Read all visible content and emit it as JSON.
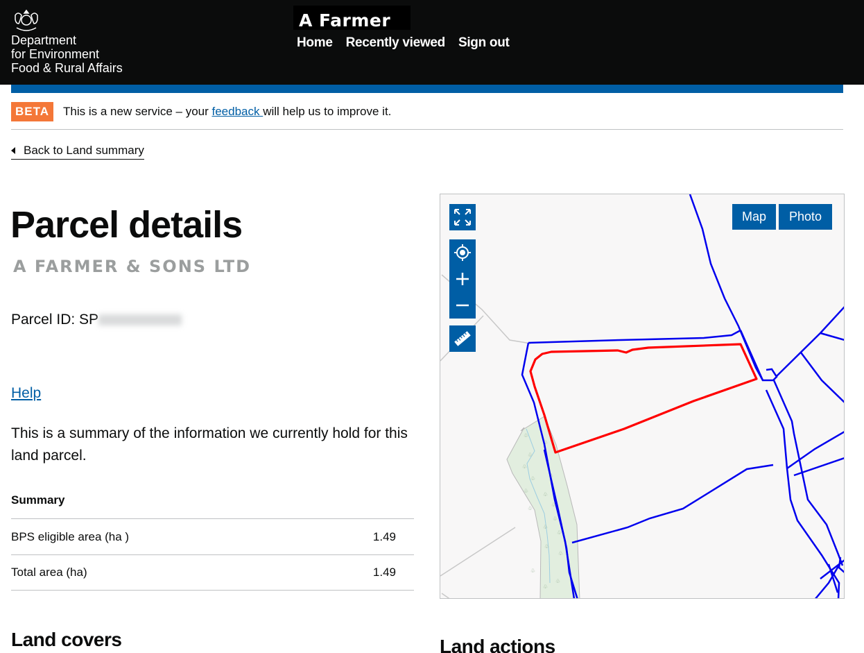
{
  "header": {
    "department_lines": [
      "Department",
      "for Environment",
      "Food & Rural Affairs"
    ],
    "user_name": "A Farmer",
    "nav": [
      {
        "label": "Home"
      },
      {
        "label": "Recently viewed"
      },
      {
        "label": "Sign out"
      }
    ]
  },
  "beta_banner": {
    "tag": "BETA",
    "text_before": "This is a new service – your ",
    "link": "feedback ",
    "text_after": " will help us to improve it."
  },
  "back_link": "Back to Land summary",
  "page": {
    "title": "Parcel details",
    "caption": "A FARMER & SONS LTD",
    "parcel_id_label": "Parcel ID: ",
    "parcel_id_visible": "SP",
    "help_link": "Help",
    "lead": "This is a summary of the information we currently hold for this land parcel."
  },
  "summary": {
    "title": "Summary",
    "rows": [
      {
        "label": "BPS eligible area (ha )",
        "value": "1.49"
      },
      {
        "label": "Total area (ha)",
        "value": "1.49"
      }
    ]
  },
  "sections": {
    "land_covers": "Land covers",
    "land_actions": "Land actions"
  },
  "map": {
    "layer_buttons": [
      {
        "label": "Map"
      },
      {
        "label": "Photo"
      }
    ],
    "controls": [
      "fullscreen-icon",
      "locate-icon",
      "zoom-in-icon",
      "zoom-out-icon",
      "measure-icon"
    ],
    "colors": {
      "selected_parcel": "#ff0000",
      "parcel_boundary": "#0000ee",
      "woodland": "#e2eedf"
    }
  },
  "colors": {
    "header_bg": "#0b0c0c",
    "brand_blue": "#005ea5",
    "beta_orange": "#f47738",
    "link": "#005ea5"
  }
}
